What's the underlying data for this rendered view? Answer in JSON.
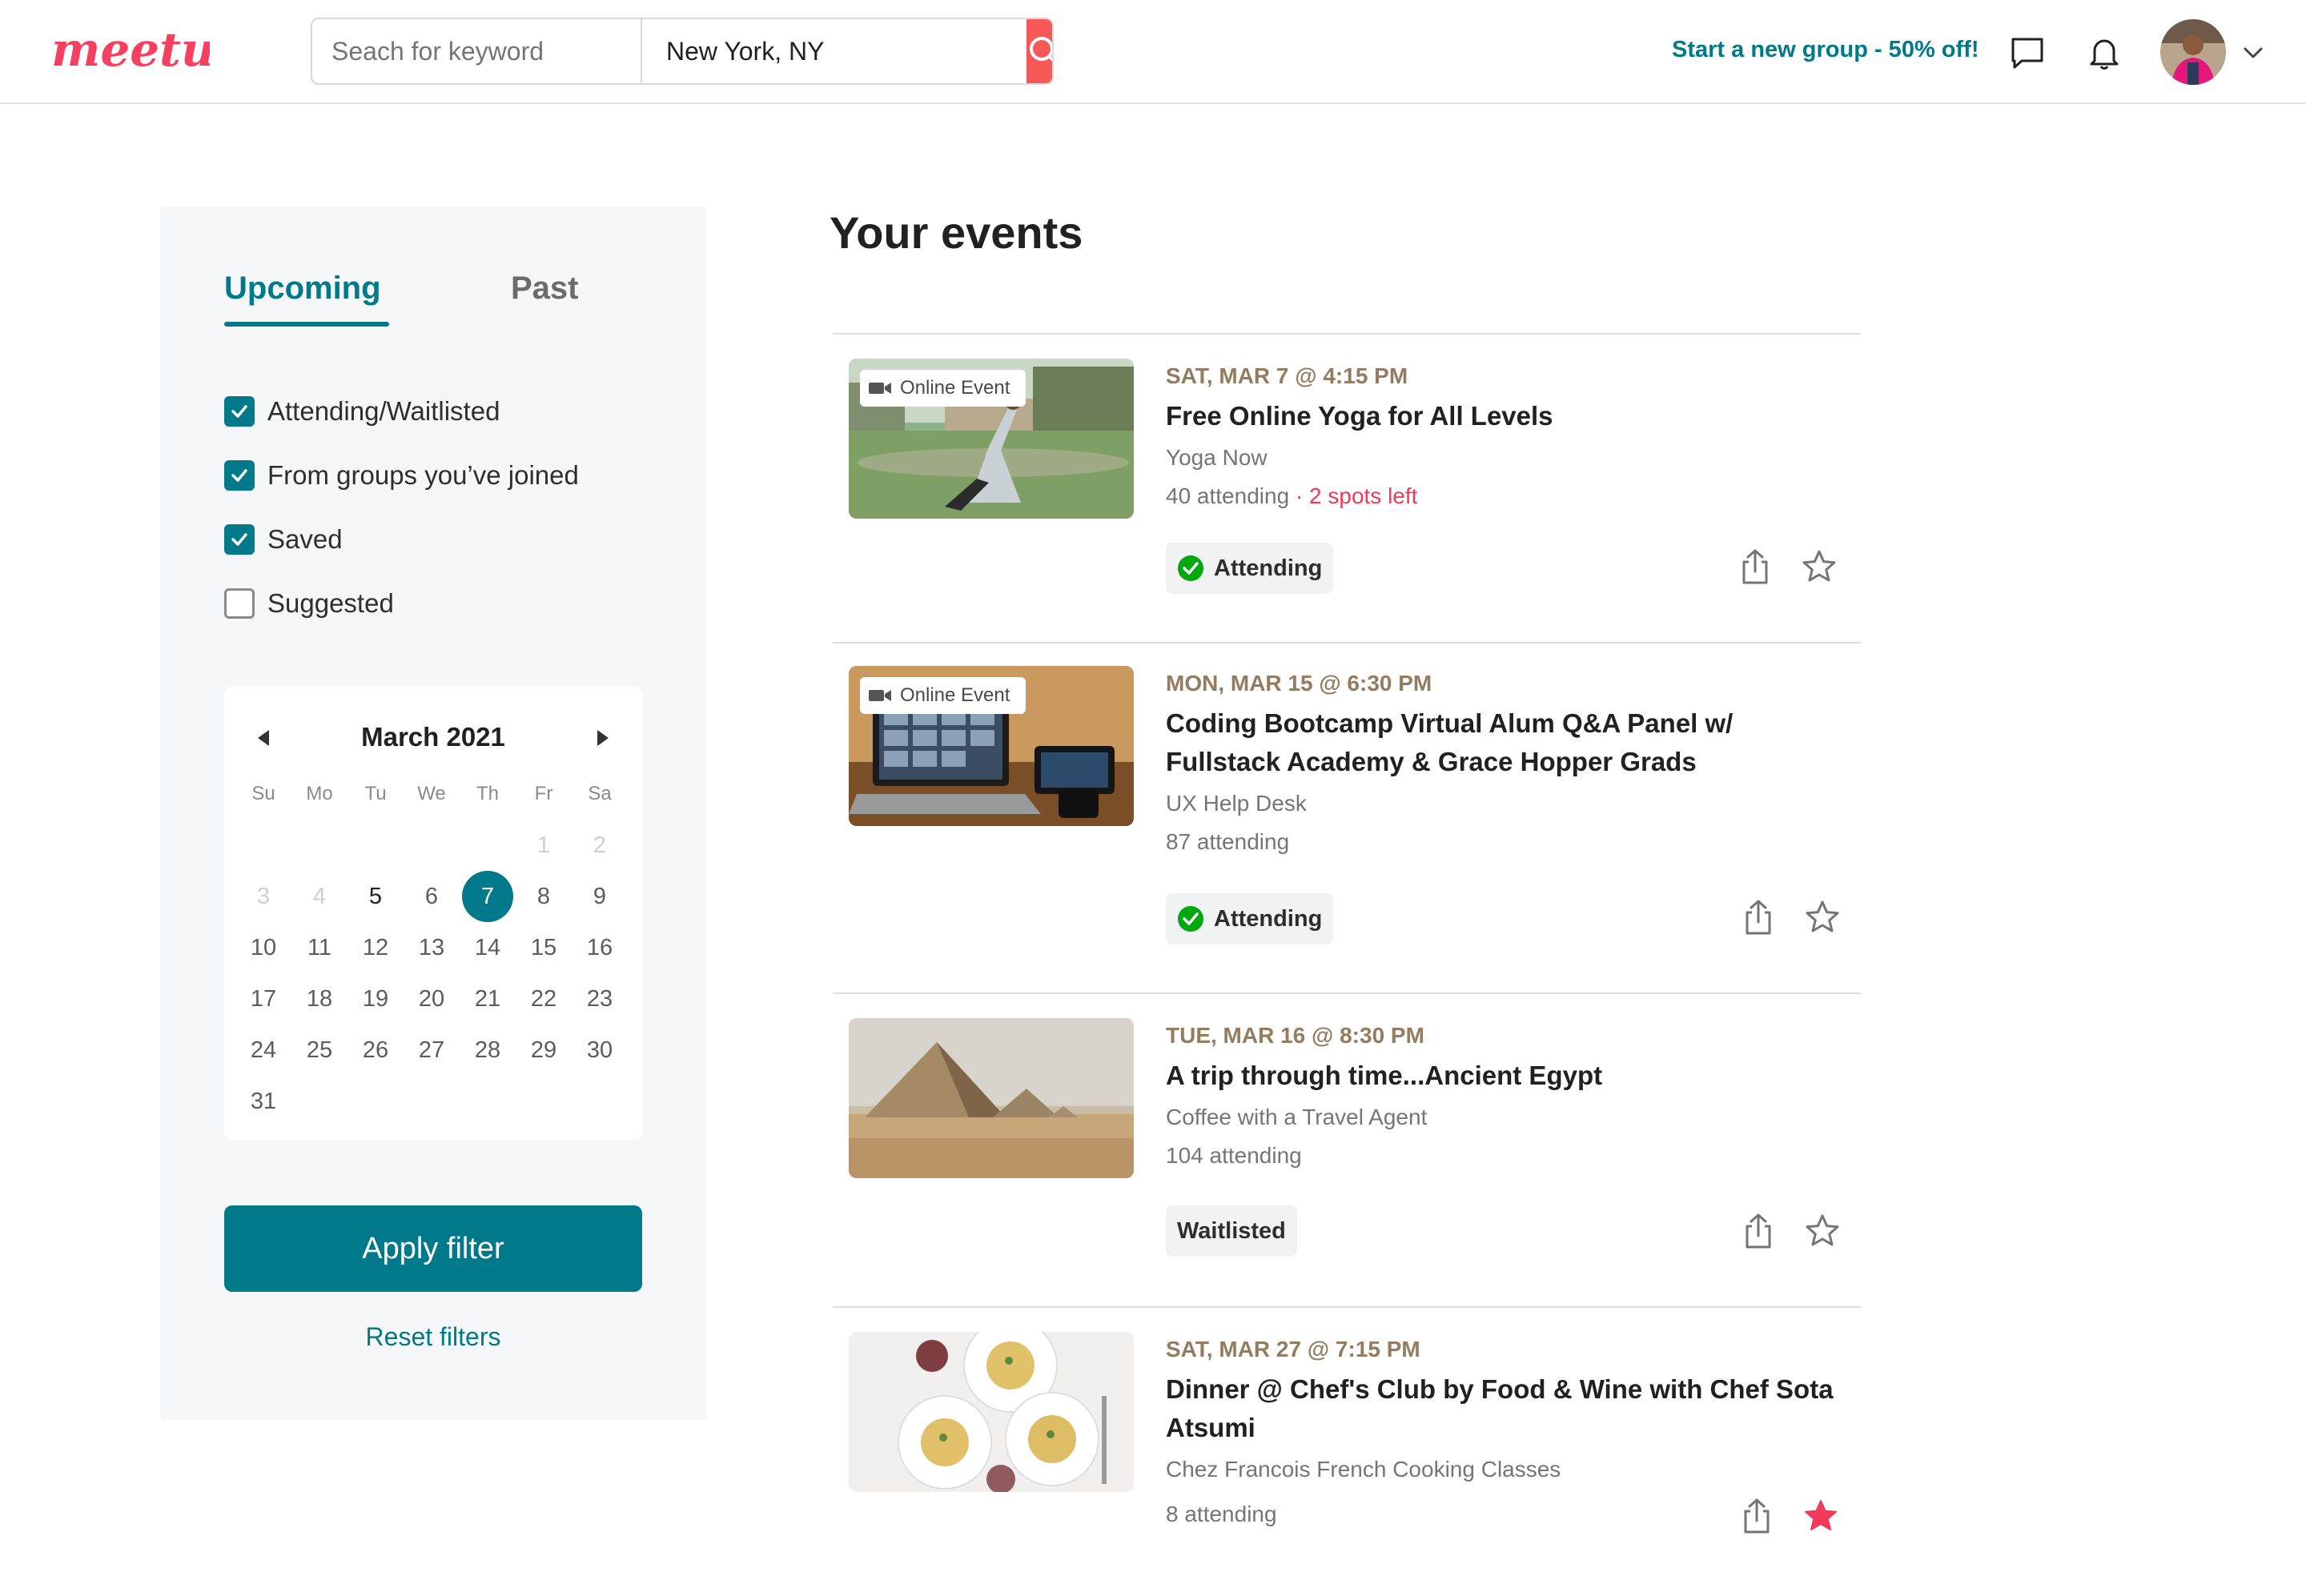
{
  "header": {
    "logo_text": "meetup",
    "search_placeholder": "Seach for keyword",
    "location_value": "New York, NY",
    "start_group_label": "Start a new group - 50% off!",
    "icons": [
      "search-icon",
      "chat-icon",
      "bell-icon",
      "chevron-down-icon"
    ]
  },
  "sidebar": {
    "tabs": [
      {
        "label": "Upcoming",
        "active": true
      },
      {
        "label": "Past",
        "active": false
      }
    ],
    "filters": [
      {
        "label": "Attending/Waitlisted",
        "checked": true
      },
      {
        "label": "From groups you’ve joined",
        "checked": true
      },
      {
        "label": "Saved",
        "checked": true
      },
      {
        "label": "Suggested",
        "checked": false
      }
    ],
    "calendar": {
      "title": "March 2021",
      "weekdays": [
        "Su",
        "Mo",
        "Tu",
        "We",
        "Th",
        "Fr",
        "Sa"
      ],
      "leading_blanks": 5,
      "muted_days": [
        1,
        2,
        3,
        4
      ],
      "bold_days": [
        5
      ],
      "selected_day": 7,
      "days_in_month": 31
    },
    "apply_label": "Apply filter",
    "reset_label": "Reset filters"
  },
  "main": {
    "title": "Your events",
    "events": [
      {
        "online_badge": "Online Event",
        "date": "SAT, MAR 7 @ 4:15 PM",
        "title": "Free Online Yoga for All Levels",
        "group": "Yoga Now",
        "attending": "40 attending",
        "spots": "· 2 spots left",
        "status": "Attending",
        "starred": false
      },
      {
        "online_badge": "Online Event",
        "date": "MON, MAR 15 @ 6:30 PM",
        "title": "Coding Bootcamp Virtual Alum Q&A Panel w/ Fullstack Academy & Grace Hopper Grads",
        "group": "UX Help Desk",
        "attending": "87 attending",
        "status": "Attending",
        "starred": false
      },
      {
        "date": "TUE, MAR 16 @ 8:30 PM",
        "title": "A trip through time...Ancient Egypt",
        "group": "Coffee with a Travel Agent",
        "attending": "104 attending",
        "status": "Waitlisted",
        "starred": false
      },
      {
        "date": "SAT, MAR 27 @ 7:15 PM",
        "title": "Dinner @ Chef's Club by Food & Wine with Chef Sota Atsumi",
        "group": "Chez Francois French Cooking Classes",
        "attending": "8 attending",
        "starred": true
      }
    ]
  },
  "colors": {
    "brand_red": "#f65858",
    "teal": "#00798a",
    "date_tan": "#947c5f",
    "spots_red": "#f13a59",
    "check_green": "#00a80e",
    "star_red": "#f13a59"
  }
}
